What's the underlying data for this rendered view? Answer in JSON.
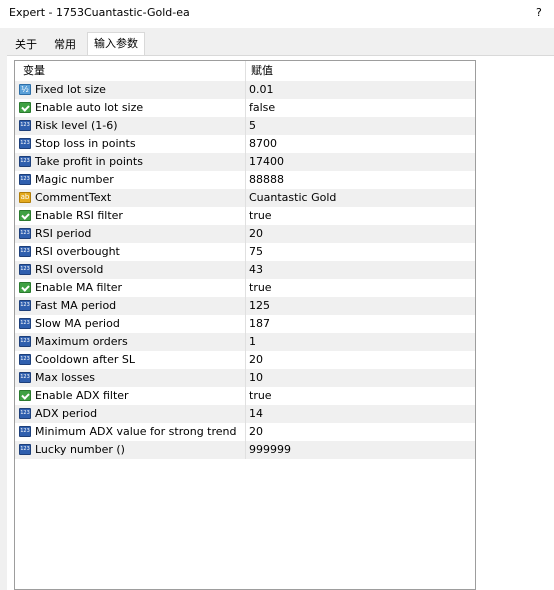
{
  "window": {
    "title": "Expert - 1753Cuantastic-Gold-ea",
    "help_label": "?"
  },
  "tabs": [
    {
      "label": "关于",
      "active": false
    },
    {
      "label": "常用",
      "active": false
    },
    {
      "label": "输入参数",
      "active": true
    }
  ],
  "params_table": {
    "columns": [
      "变量",
      "赋值"
    ],
    "rows": [
      {
        "name": "Fixed lot size",
        "value": "0.01",
        "type_icon": "double-type-icon"
      },
      {
        "name": "Enable auto lot size",
        "value": "false",
        "type_icon": "bool-type-icon"
      },
      {
        "name": "Risk level (1-6)",
        "value": "5",
        "type_icon": "int-type-icon"
      },
      {
        "name": "Stop loss in points",
        "value": "8700",
        "type_icon": "int-type-icon"
      },
      {
        "name": "Take profit in points",
        "value": "17400",
        "type_icon": "int-type-icon"
      },
      {
        "name": "Magic number",
        "value": "88888",
        "type_icon": "int-type-icon"
      },
      {
        "name": "CommentText",
        "value": "Cuantastic Gold",
        "type_icon": "string-type-icon"
      },
      {
        "name": "Enable RSI filter",
        "value": "true",
        "type_icon": "bool-type-icon"
      },
      {
        "name": "RSI period",
        "value": "20",
        "type_icon": "int-type-icon"
      },
      {
        "name": "RSI overbought",
        "value": "75",
        "type_icon": "int-type-icon"
      },
      {
        "name": "RSI oversold",
        "value": "43",
        "type_icon": "int-type-icon"
      },
      {
        "name": "Enable MA filter",
        "value": "true",
        "type_icon": "bool-type-icon"
      },
      {
        "name": "Fast MA period",
        "value": "125",
        "type_icon": "int-type-icon"
      },
      {
        "name": "Slow MA period",
        "value": "187",
        "type_icon": "int-type-icon"
      },
      {
        "name": "Maximum orders",
        "value": "1",
        "type_icon": "int-type-icon"
      },
      {
        "name": "Cooldown after SL",
        "value": "20",
        "type_icon": "int-type-icon"
      },
      {
        "name": "Max losses",
        "value": "10",
        "type_icon": "int-type-icon"
      },
      {
        "name": "Enable ADX filter",
        "value": "true",
        "type_icon": "bool-type-icon"
      },
      {
        "name": "ADX period",
        "value": "14",
        "type_icon": "int-type-icon"
      },
      {
        "name": "Minimum ADX value for strong trend",
        "value": "20",
        "type_icon": "int-type-icon"
      },
      {
        "name": "Lucky number ()",
        "value": "999999",
        "type_icon": "int-type-icon"
      }
    ]
  },
  "colors": {
    "dialog_bg": "#f0f0f0",
    "row_alt": "#f0f0f0",
    "grid_border": "#9d9d9d",
    "int_icon": "#2f5fae",
    "bool_icon": "#3fa143",
    "string_icon": "#e3a91f",
    "double_icon": "#5aa0d8"
  }
}
